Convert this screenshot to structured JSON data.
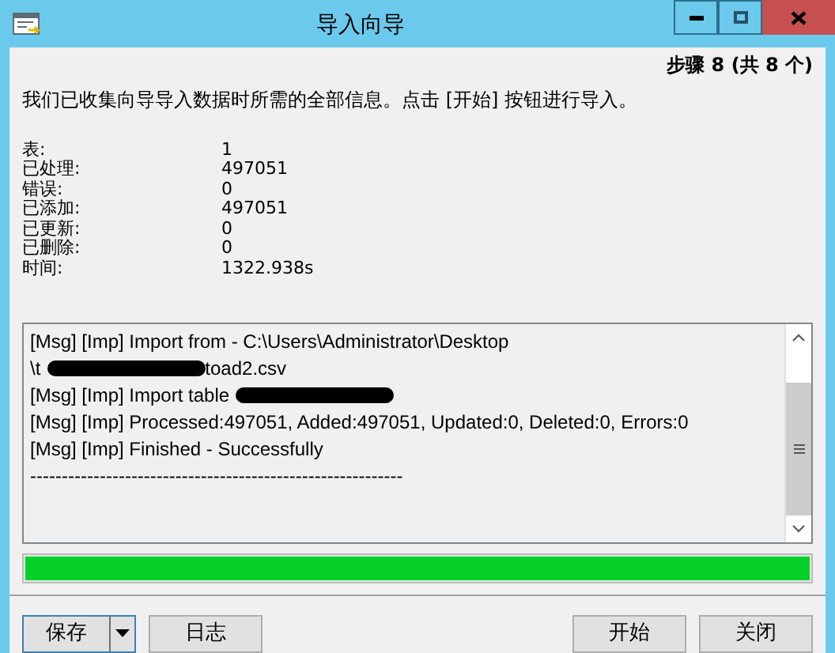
{
  "window": {
    "title": "导入向导"
  },
  "step": "步骤 8 (共 8 个)",
  "description": "我们已收集向导导入数据时所需的全部信息。点击 [开始] 按钮进行导入。",
  "stats": [
    {
      "label": "表:",
      "value": "1"
    },
    {
      "label": "已处理:",
      "value": "497051"
    },
    {
      "label": "错误:",
      "value": "0"
    },
    {
      "label": "已添加:",
      "value": "497051"
    },
    {
      "label": "已更新:",
      "value": "0"
    },
    {
      "label": "已删除:",
      "value": "0"
    },
    {
      "label": "时间:",
      "value": "1322.938s"
    }
  ],
  "log": [
    {
      "prefix": "[Msg] [Imp] Import from - C:\\Users\\Administrator\\Desktop",
      "redacted": false
    },
    {
      "prefix": "\\t",
      "redacted": true,
      "suffix": "toad2.csv"
    },
    {
      "prefix": "[Msg] [Imp] Import table",
      "redacted": true
    },
    {
      "prefix": "[Msg] [Imp] Processed:497051, Added:497051, Updated:0, Deleted:0, Errors:0",
      "redacted": false
    },
    {
      "prefix": "[Msg] [Imp] Finished - Successfully",
      "redacted": false
    },
    {
      "prefix": "-----------------------------------------------------------",
      "redacted": false
    }
  ],
  "progress": {
    "level": 1
  },
  "buttons_left": [
    {
      "label": "保存",
      "kind": "split"
    },
    {
      "label": "日志",
      "kind": "plain"
    }
  ],
  "buttons_right": [
    {
      "label": "开始",
      "kind": "plain"
    },
    {
      "label": "关闭",
      "kind": "plain"
    }
  ]
}
